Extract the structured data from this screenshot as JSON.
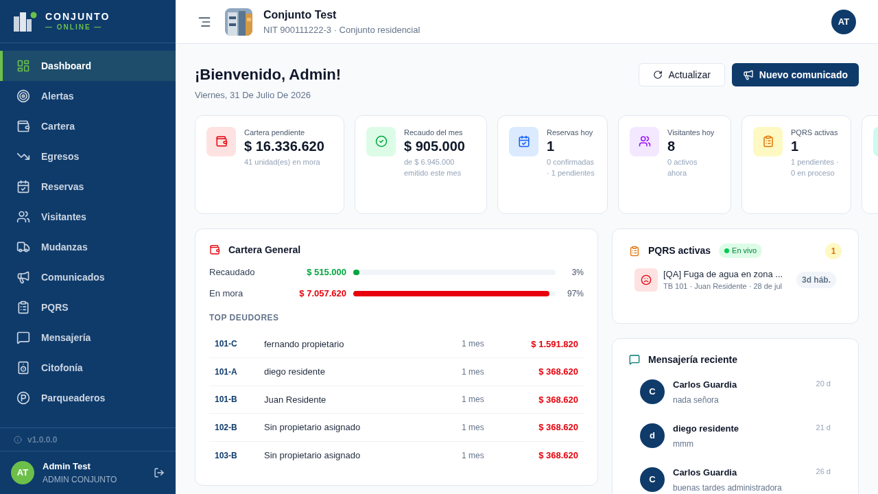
{
  "brand": {
    "name": "CONJUNTO",
    "tagline": "— ONLINE —"
  },
  "sidebar": {
    "items": [
      {
        "label": "Dashboard",
        "selected": true
      },
      {
        "label": "Alertas",
        "selected": false
      },
      {
        "label": "Cartera",
        "selected": false
      },
      {
        "label": "Egresos",
        "selected": false
      },
      {
        "label": "Reservas",
        "selected": false
      },
      {
        "label": "Visitantes",
        "selected": false
      },
      {
        "label": "Mudanzas",
        "selected": false
      },
      {
        "label": "Comunicados",
        "selected": false
      },
      {
        "label": "PQRS",
        "selected": false
      },
      {
        "label": "Mensajería",
        "selected": false
      },
      {
        "label": "Citofonía",
        "selected": false
      },
      {
        "label": "Parqueaderos",
        "selected": false
      }
    ],
    "version": "v1.0.0.0",
    "user": {
      "initials": "AT",
      "name": "Admin Test",
      "role": "ADMIN CONJUNTO"
    }
  },
  "header": {
    "title": "Conjunto Test",
    "subtitle": "NIT 900111222-3 · Conjunto residencial",
    "avatar": "AT"
  },
  "welcome": {
    "title": "¡Bienvenido, Admin!",
    "date": "Viernes, 31 De Julio De 2026"
  },
  "actions": [
    {
      "label": "Actualizar",
      "kind": "secondary"
    },
    {
      "label": "Nuevo comunicado",
      "kind": "primary"
    }
  ],
  "stats": [
    {
      "color": "#fee2e2",
      "label": "Cartera pendiente",
      "value": "$ 16.336.620",
      "note": "41 unidad(es) en mora"
    },
    {
      "color": "#dcfce7",
      "label": "Recaudo del mes",
      "value": "$ 905.000",
      "note": "de $ 6.945.000 emitido este mes"
    },
    {
      "color": "#dbeafe",
      "label": "Reservas hoy",
      "value": "1",
      "note": "0 confirmadas · 1 pendientes"
    },
    {
      "color": "#f3e8ff",
      "label": "Visitantes hoy",
      "value": "8",
      "note": "0 activos ahora"
    },
    {
      "color": "#fef9c3",
      "label": "PQRS activas",
      "value": "1",
      "note": "1 pendientes · 0 en proceso"
    },
    {
      "color": "#ccfbf1"
    }
  ],
  "cartera": {
    "title": "Cartera General",
    "bars": [
      {
        "kind": "paid",
        "label": "Recaudado",
        "amount": "$ 515.000",
        "level": 0.03,
        "percent": "3%"
      },
      {
        "kind": "overdue",
        "label": "En mora",
        "amount": "$ 7.057.620",
        "level": 0.97,
        "percent": "97%"
      }
    ],
    "section": "TOP DEUDORES",
    "rows": [
      {
        "unit": "101-C",
        "name": "fernando propietario",
        "age": "1 mes",
        "amount": "$ 1.591.820"
      },
      {
        "unit": "101-A",
        "name": "diego residente",
        "age": "1 mes",
        "amount": "$ 368.620"
      },
      {
        "unit": "101-B",
        "name": "Juan Residente",
        "age": "1 mes",
        "amount": "$ 368.620"
      },
      {
        "unit": "102-B",
        "name": "Sin propietario asignado",
        "age": "1 mes",
        "amount": "$ 368.620"
      },
      {
        "unit": "103-B",
        "name": "Sin propietario asignado",
        "age": "1 mes",
        "amount": "$ 368.620"
      }
    ]
  },
  "pqrs": {
    "title": "PQRS activas",
    "badge": "En vivo",
    "count": "1",
    "items": [
      {
        "title": "[QA] Fuga de agua en zona ...",
        "meta": "TB 101 · Juan Residente · 28 de jul",
        "age": "3d háb."
      }
    ]
  },
  "messages": {
    "title": "Mensajería reciente",
    "items": [
      {
        "initial": "C",
        "name": "Carlos Guardia",
        "text": "nada señora",
        "time": "20 d"
      },
      {
        "initial": "d",
        "name": "diego residente",
        "text": "mmm",
        "time": "21 d"
      },
      {
        "initial": "C",
        "name": "Carlos Guardia",
        "text": "buenas tardes administradora",
        "time": "26 d"
      }
    ]
  }
}
